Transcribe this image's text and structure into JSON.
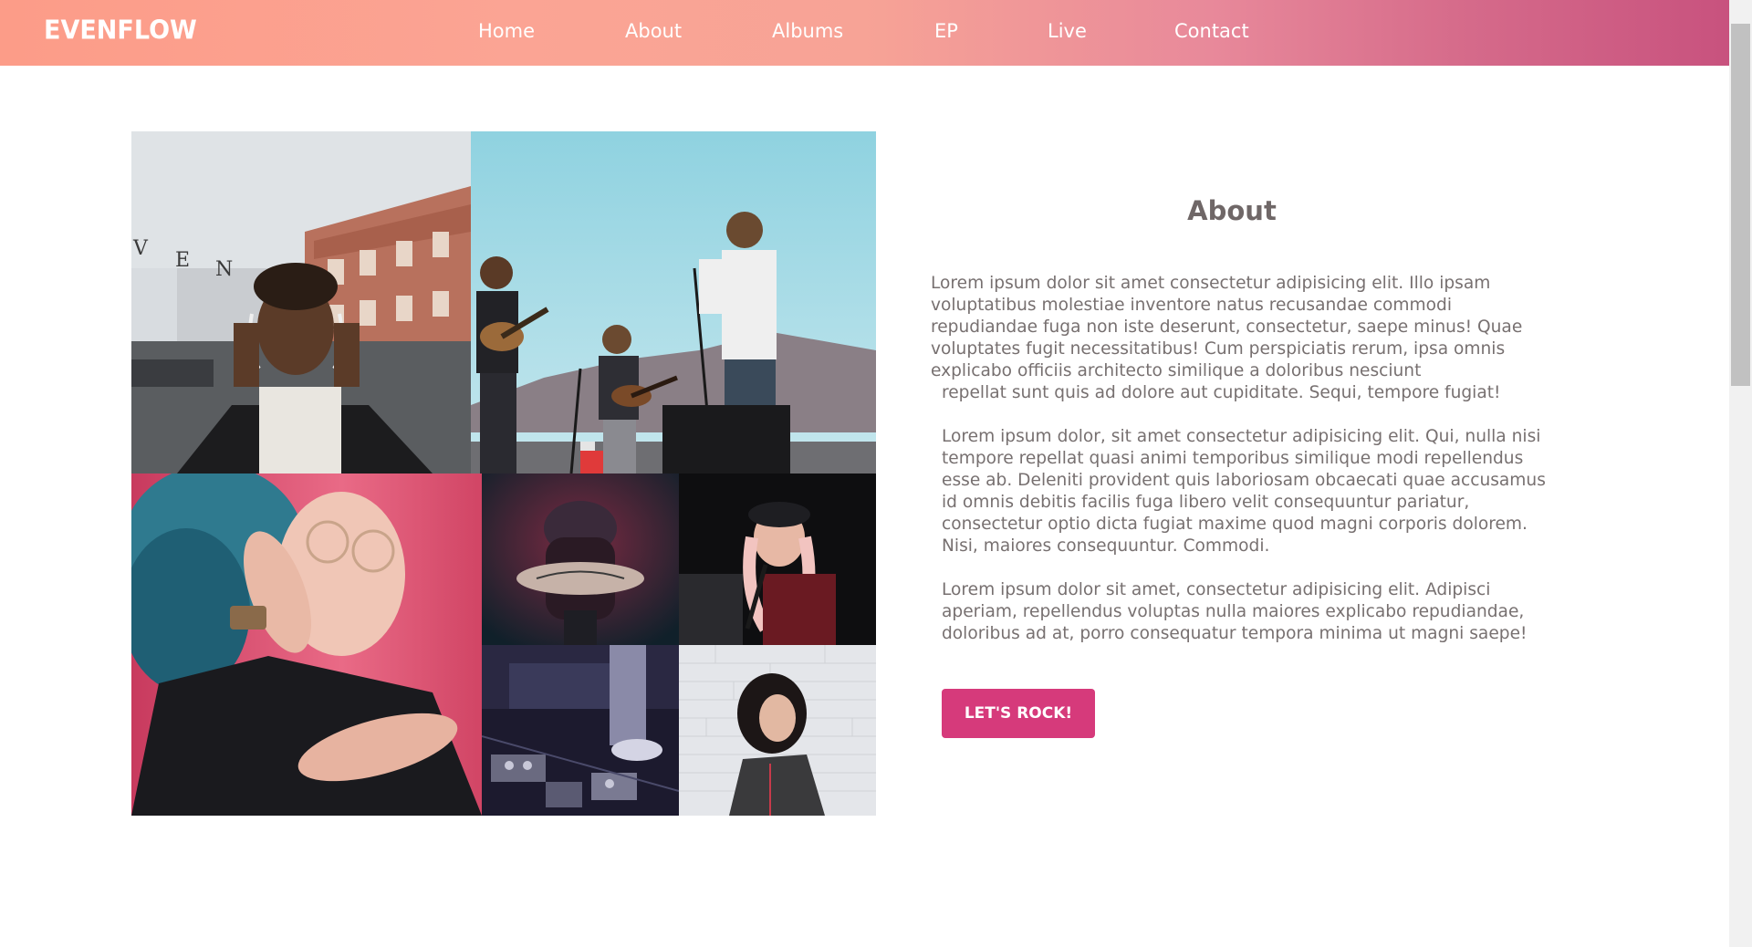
{
  "brand": {
    "logo_text": "EVENFLOW"
  },
  "nav": {
    "items": [
      {
        "label": "Home"
      },
      {
        "label": "About"
      },
      {
        "label": "Albums"
      },
      {
        "label": "EP"
      },
      {
        "label": "Live"
      },
      {
        "label": "Contact"
      }
    ]
  },
  "about": {
    "title": "About",
    "paragraph1_part1": "Lorem ipsum dolor sit amet consectetur adipisicing elit. Illo ipsam voluptatibus molestiae inventore natus recusandae commodi repudiandae fuga non iste deserunt, consectetur, saepe minus! Quae voluptates fugit necessitatibus! Cum perspiciatis rerum, ipsa omnis explicabo officiis architecto similique a doloribus nesciunt",
    "paragraph1_part2": "repellat sunt quis ad dolore aut cupiditate. Sequi, tempore fugiat!",
    "paragraph2": "Lorem ipsum dolor, sit amet consectetur adipisicing elit. Qui, nulla nisi tempore repellat quasi animi temporibus similique modi repellendus esse ab. Deleniti provident quis laboriosam obcaecati quae accusamus id omnis debitis facilis fuga libero velit consequuntur pariatur, consectetur optio dicta fugiat maxime quod magni corporis dolorem. Nisi, maiores consequuntur. Commodi.",
    "paragraph3": "Lorem ipsum dolor sit amet, consectetur adipisicing elit. Adipisci aperiam, repellendus voluptas nulla maiores explicabo repudiandae, doloribus ad at, porro consequatur tempora minima ut magni saepe!",
    "cta_label": "LET'S ROCK!"
  },
  "colors": {
    "nav_gradient_start": "#fc9c88",
    "nav_gradient_end": "#c8527e",
    "accent": "#d63a7b",
    "body_text": "#777070"
  }
}
